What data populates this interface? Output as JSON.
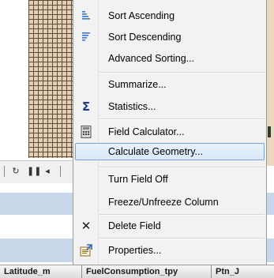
{
  "menu": {
    "items": [
      {
        "label": "Sort Ascending",
        "icon": "sort-ascending-icon"
      },
      {
        "label": "Sort Descending",
        "icon": "sort-descending-icon"
      },
      {
        "label": "Advanced Sorting...",
        "icon": ""
      },
      {
        "label": "Summarize...",
        "icon": ""
      },
      {
        "label": "Statistics...",
        "icon": "sigma-icon"
      },
      {
        "label": "Field Calculator...",
        "icon": "calculator-icon"
      },
      {
        "label": "Calculate Geometry...",
        "icon": "",
        "highlighted": true
      },
      {
        "label": "Turn Field Off",
        "icon": ""
      },
      {
        "label": "Freeze/Unfreeze Column",
        "icon": ""
      },
      {
        "label": "Delete Field",
        "icon": "delete-x-icon"
      },
      {
        "label": "Properties...",
        "icon": "properties-icon"
      }
    ]
  },
  "table": {
    "columns": [
      "Latitude_m",
      "FuelConsumption_tpy",
      "Ptn_J"
    ]
  },
  "colors": {
    "highlight_border": "#7da2ce",
    "selection_band": "#c9d7ea",
    "delete_icon": "#1a1a1a",
    "sort_icon": "#3a78c9"
  }
}
